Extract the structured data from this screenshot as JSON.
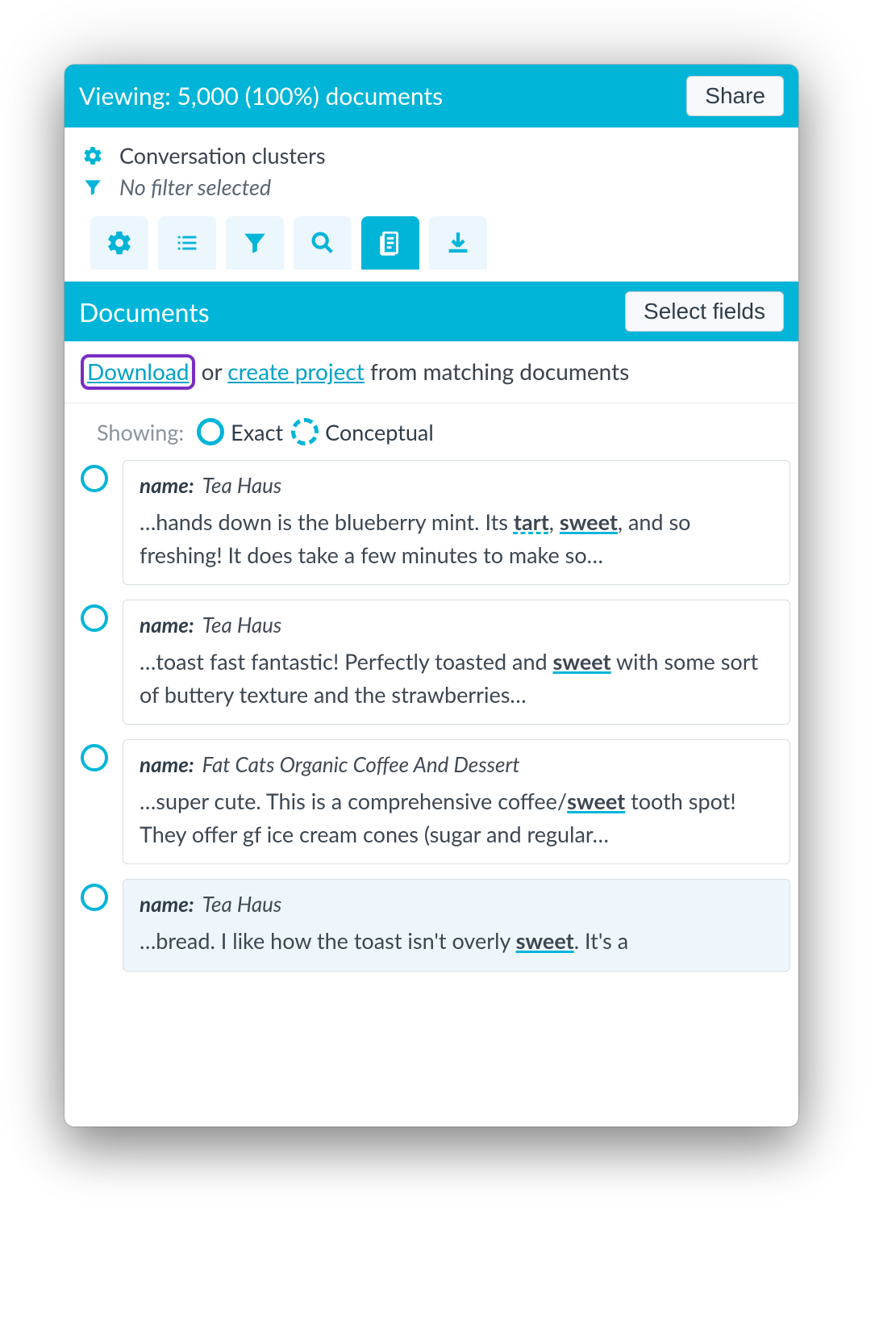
{
  "topbar": {
    "title": "Viewing: 5,000 (100%) documents",
    "share": "Share"
  },
  "context": {
    "clusters": "Conversation clusters",
    "filter": "No filter selected"
  },
  "section": {
    "title": "Documents",
    "select_fields": "Select fields"
  },
  "actions": {
    "download": "Download",
    "or": " or ",
    "create_project": "create project",
    "suffix": " from matching documents"
  },
  "showing": {
    "label": "Showing:",
    "exact": "Exact",
    "conceptual": "Conceptual"
  },
  "docs": [
    {
      "name_label": "name:",
      "name": "Tea Haus",
      "snippet_pre": "…hands down is the blueberry mint. Its ",
      "hit1": "tart",
      "mid1": ", ",
      "hit2": "sweet",
      "snippet_post": ", and so freshing! It does take a few minutes to make so…",
      "match": "exact"
    },
    {
      "name_label": "name:",
      "name": "Tea Haus",
      "snippet_pre": "…toast fast fantastic! Perfectly toasted and ",
      "hit1": "sweet",
      "mid1": "",
      "hit2": "",
      "snippet_post": " with some sort of buttery texture and the strawberries…",
      "match": "exact"
    },
    {
      "name_label": "name:",
      "name": "Fat Cats Organic Coffee And Dessert",
      "snippet_pre": "…super cute. This is a comprehensive coffee/",
      "hit1": "sweet",
      "mid1": "",
      "hit2": "",
      "snippet_post": " tooth spot! They offer gf ice cream cones (sugar and regular…",
      "match": "exact"
    },
    {
      "name_label": "name:",
      "name": "Tea Haus",
      "snippet_pre": "…bread. I like how the toast isn't overly ",
      "hit1": "sweet",
      "mid1": "",
      "hit2": "",
      "snippet_post": ". It's a",
      "match": "exact"
    }
  ]
}
